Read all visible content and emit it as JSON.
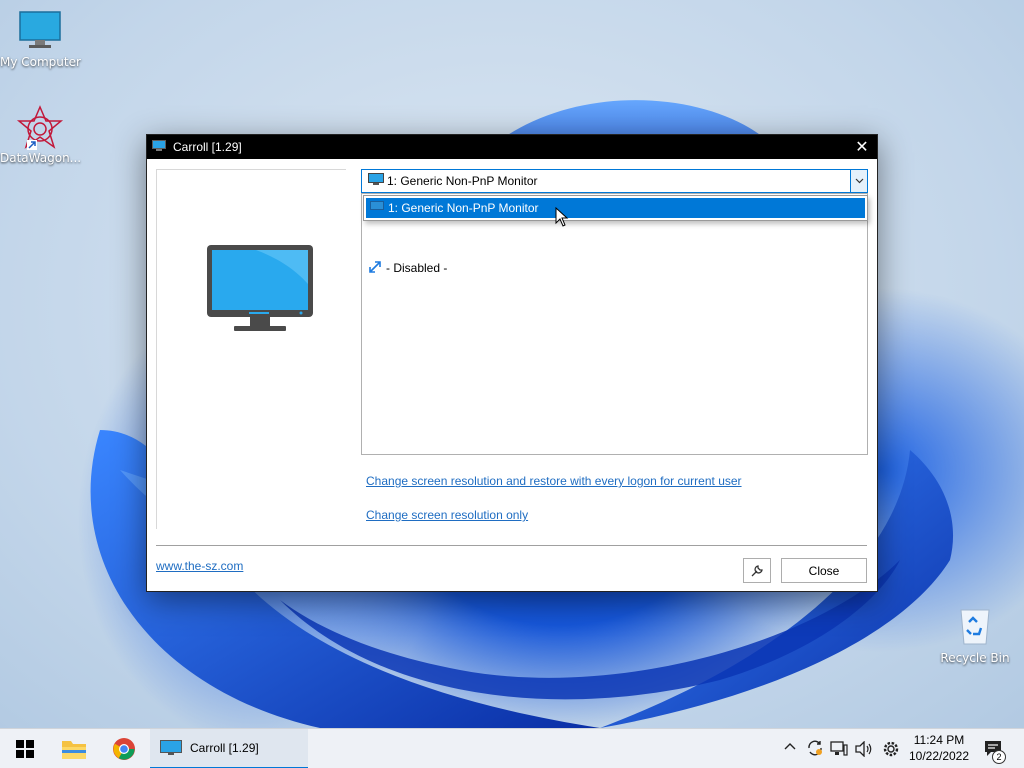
{
  "desktop": {
    "icons": [
      {
        "label": "My Computer"
      },
      {
        "label": "DataWagon..."
      },
      {
        "label": "Recycle Bin"
      }
    ]
  },
  "window": {
    "title": "Carroll [1.29]",
    "close_glyph": "✕",
    "combo_value": "1: Generic Non-PnP Monitor",
    "dropdown_option": "1: Generic Non-PnP Monitor",
    "list_items": [
      "- Disabled -"
    ],
    "link_restore": "Change screen resolution and restore with every logon for current user",
    "link_only": "Change screen resolution only",
    "website_link": "www.the-sz.com",
    "settings_icon": "wrench-icon",
    "close_button": "Close"
  },
  "taskbar": {
    "app_label": "Carroll [1.29]",
    "time": "11:24 PM",
    "date": "10/22/2022",
    "notification_count": "2"
  },
  "colors": {
    "accent": "#0078d7",
    "link": "#1f6dc2",
    "titlebar": "#000000"
  }
}
